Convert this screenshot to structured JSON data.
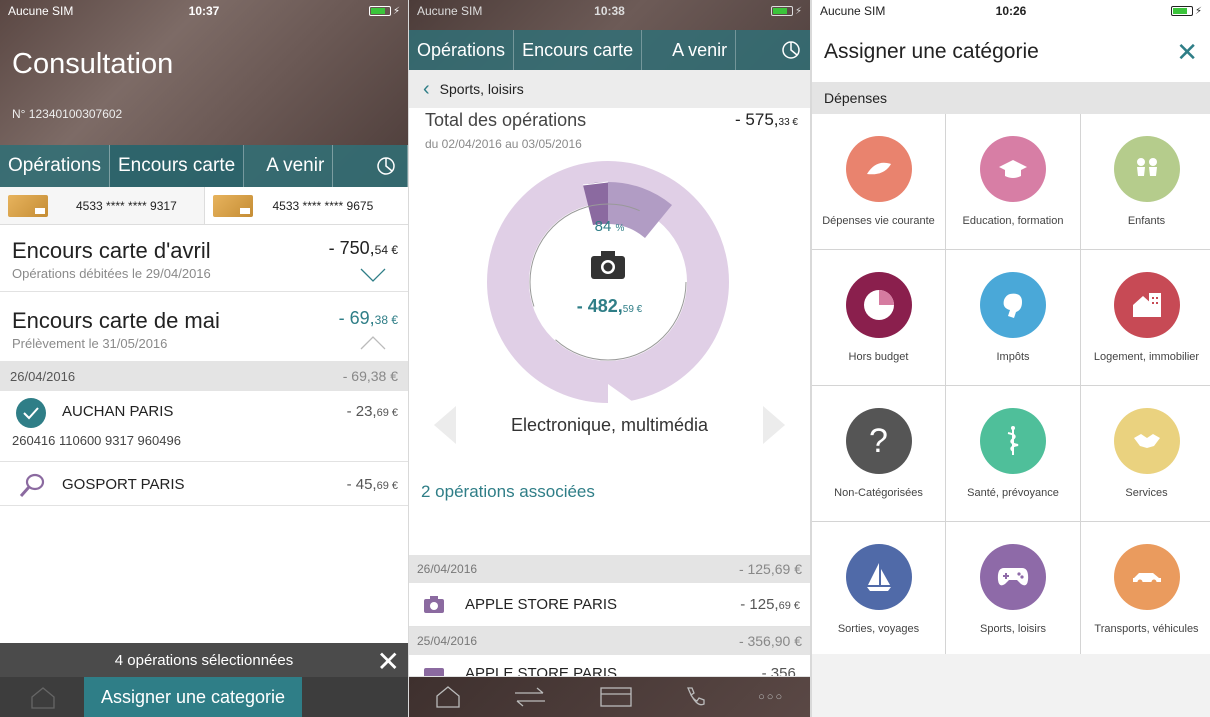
{
  "colors": {
    "teal": "#2f7e87",
    "purple": "#8b6aa0",
    "light_purple": "#e0cfe6"
  },
  "screen1": {
    "status": {
      "carrier": "Aucune SIM",
      "time": "10:37"
    },
    "title": "Consultation",
    "account_number": "N° 12340100307602",
    "tabs": [
      "Opérations",
      "Encours carte",
      "A venir"
    ],
    "tab_icon": "pie-chart-icon",
    "cards": [
      "4533 **** **** 9317",
      "4533 **** **** 9675"
    ],
    "encours": [
      {
        "title": "Encours carte d'avril",
        "subtitle": "Opérations débitées le 29/04/2016",
        "amount_main": "- 750,",
        "amount_cents": "54 €"
      },
      {
        "title": "Encours carte de mai",
        "subtitle": "Prélèvement le 31/05/2016",
        "amount_main": "- 69,",
        "amount_cents": "38 €"
      }
    ],
    "date_group": {
      "date": "26/04/2016",
      "total": "- 69,38 €"
    },
    "operations": [
      {
        "name": "AUCHAN PARIS",
        "detail": "260416 110600 9317 960496",
        "amount_main": "- 23,",
        "amount_cents": "69 €",
        "icon": "check-circle-icon"
      },
      {
        "name": "GOSPORT PARIS",
        "amount_main": "- 45,",
        "amount_cents": "69 €",
        "icon": "sports-racket-icon"
      }
    ],
    "selection_text": "4 opérations sélectionnées",
    "assign_button": "Assigner une categorie"
  },
  "screen2": {
    "status": {
      "carrier": "Aucune SIM",
      "time": "10:38"
    },
    "tabs": [
      "Opérations",
      "Encours carte",
      "A venir"
    ],
    "breadcrumb": "Sports, loisirs",
    "total_label": "Total des opérations",
    "total_amount_main": "- 575,",
    "total_amount_cents": "33 €",
    "date_range": "du 02/04/2016 au 03/05/2016",
    "percent_main": "84",
    "percent_unit": "%",
    "center_amount_main": "- 482,",
    "center_amount_cents": "59 €",
    "category_name": "Electronique, multimédia",
    "associated": "2 opérations associées",
    "groups": [
      {
        "date": "26/04/2016",
        "total": "- 125,69 €",
        "op": {
          "name": "APPLE STORE PARIS",
          "amount_main": "- 125,",
          "amount_cents": "69 €"
        }
      },
      {
        "date": "25/04/2016",
        "total": "- 356,90 €",
        "op": {
          "name": "APPLE STORE PARIS",
          "amount_main": "- 356,",
          "amount_cents": ""
        }
      }
    ],
    "bottom_nav": [
      "home-icon",
      "transfer-icon",
      "card-icon",
      "phone-icon",
      "more-icon"
    ],
    "bottom_more": "○○○"
  },
  "screen3": {
    "status": {
      "carrier": "Aucune SIM",
      "time": "10:26"
    },
    "title": "Assigner une catégorie",
    "section": "Dépenses",
    "categories": [
      {
        "label": "Dépenses vie courante",
        "color": "#e9836e",
        "icon": "bread-icon"
      },
      {
        "label": "Education, formation",
        "color": "#d77ea5",
        "icon": "graduation-cap-icon"
      },
      {
        "label": "Enfants",
        "color": "#b5cc8c",
        "icon": "children-icon"
      },
      {
        "label": "Hors budget",
        "color": "#8a1f4d",
        "icon": "pie-icon"
      },
      {
        "label": "Impôts",
        "color": "#4aa8d8",
        "icon": "tax-icon"
      },
      {
        "label": "Logement, immobilier",
        "color": "#c74a55",
        "icon": "house-icon"
      },
      {
        "label": "Non-Catégorisées",
        "color": "#555555",
        "icon": "question-icon"
      },
      {
        "label": "Santé, prévoyance",
        "color": "#4fbf9a",
        "icon": "caduceus-icon"
      },
      {
        "label": "Services",
        "color": "#ead27f",
        "icon": "handshake-icon"
      },
      {
        "label": "Sorties, voyages",
        "color": "#506aa8",
        "icon": "sailboat-icon"
      },
      {
        "label": "Sports, loisirs",
        "color": "#8e6aa8",
        "icon": "gamepad-icon"
      },
      {
        "label": "Transports, véhicules",
        "color": "#ea9b5e",
        "icon": "car-icon"
      }
    ],
    "question_glyph": "?"
  }
}
